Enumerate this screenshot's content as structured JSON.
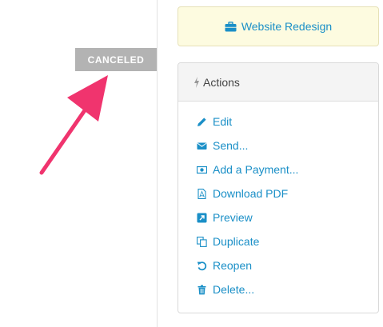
{
  "document": {
    "status": "CANCELED"
  },
  "project": {
    "name": "Website Redesign",
    "icon": "briefcase-icon"
  },
  "actions": {
    "title": "Actions",
    "icon": "lightning-icon",
    "items": [
      {
        "label": "Edit",
        "icon": "pencil-icon"
      },
      {
        "label": "Send...",
        "icon": "envelope-icon"
      },
      {
        "label": "Add a Payment...",
        "icon": "money-icon"
      },
      {
        "label": "Download PDF",
        "icon": "pdf-file-icon"
      },
      {
        "label": "Preview",
        "icon": "external-link-icon"
      },
      {
        "label": "Duplicate",
        "icon": "copy-icon"
      },
      {
        "label": "Reopen",
        "icon": "undo-icon"
      },
      {
        "label": "Delete...",
        "icon": "trash-icon"
      }
    ]
  },
  "colors": {
    "link": "#1a8fc7",
    "status_badge": "#b3b3b3",
    "annotation_arrow": "#f0346e",
    "project_bg": "#fdfbe0"
  }
}
